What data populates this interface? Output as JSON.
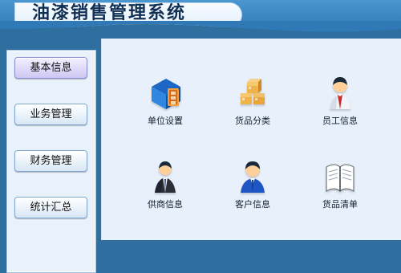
{
  "app": {
    "title": "油漆销售管理系统"
  },
  "sidebar": {
    "items": [
      {
        "label": "基本信息",
        "active": true
      },
      {
        "label": "业务管理",
        "active": false
      },
      {
        "label": "财务管理",
        "active": false
      },
      {
        "label": "统计汇总",
        "active": false
      }
    ]
  },
  "modules": [
    {
      "label": "单位设置",
      "icon": "building-icon"
    },
    {
      "label": "货品分类",
      "icon": "boxes-icon"
    },
    {
      "label": "员工信息",
      "icon": "employee-icon"
    },
    {
      "label": "供商信息",
      "icon": "supplier-icon"
    },
    {
      "label": "客户信息",
      "icon": "customer-icon"
    },
    {
      "label": "货品清单",
      "icon": "notebook-icon"
    }
  ],
  "colors": {
    "frame": "#2f6f9f",
    "content": "#e8f0fb",
    "active_button": "#cfc8f3"
  }
}
